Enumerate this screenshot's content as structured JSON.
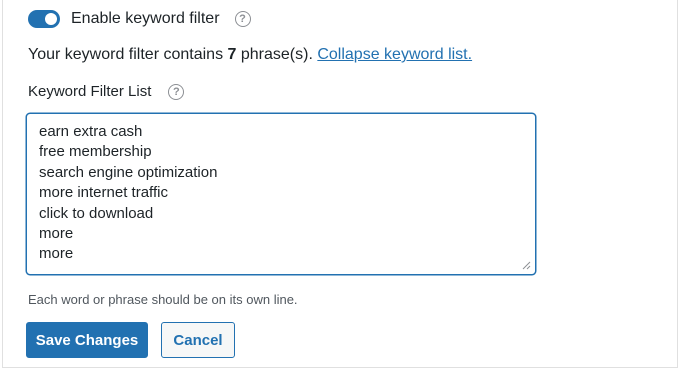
{
  "toggle": {
    "label": "Enable keyword filter",
    "enabled": true,
    "help_icon": "question-circle-icon"
  },
  "summary": {
    "prefix": "Your keyword filter contains ",
    "count": "7",
    "suffix": " phrase(s). ",
    "link_label": "Collapse keyword list."
  },
  "field": {
    "label": "Keyword Filter List",
    "help_icon": "question-circle-icon",
    "lines": [
      "earn extra cash",
      "free membership",
      "search engine optimization",
      "more internet traffic",
      "click to download",
      "more",
      "more"
    ],
    "hint": "Each word or phrase should be on its own line."
  },
  "actions": {
    "save_label": "Save Changes",
    "cancel_label": "Cancel"
  },
  "colors": {
    "accent": "#2271b1",
    "text": "#1d2327",
    "muted": "#50575e",
    "icon": "#8c8f94"
  }
}
